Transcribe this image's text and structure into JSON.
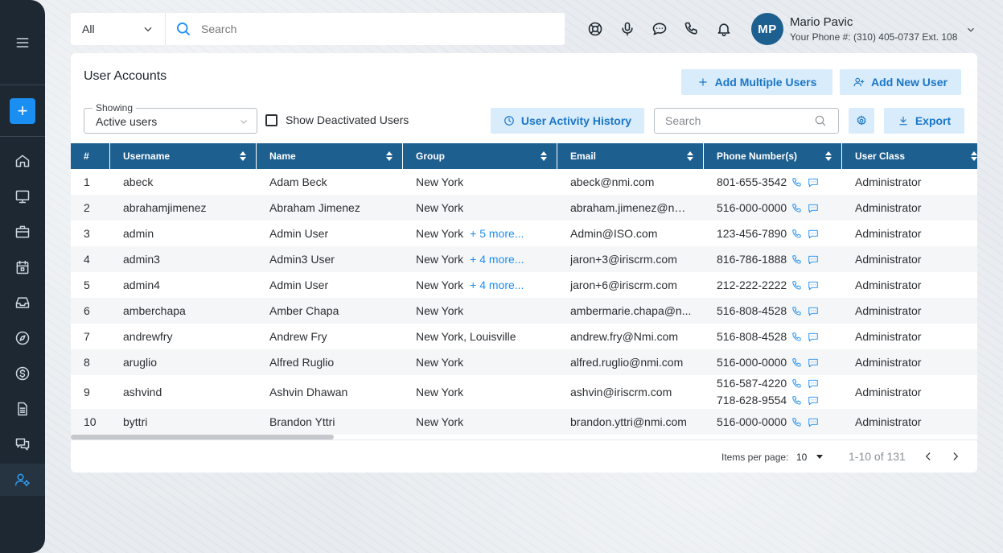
{
  "top": {
    "category": "All",
    "search_placeholder": "Search",
    "user_initials": "MP",
    "user_name": "Mario Pavic",
    "user_phone": "Your Phone #: (310) 405-0737 Ext. 108"
  },
  "page": {
    "title": "User Accounts",
    "add_multiple_label": "Add Multiple Users",
    "add_new_label": "Add New User",
    "showing_label": "Showing",
    "showing_value": "Active users",
    "deactivated_label": "Show Deactivated Users",
    "activity_label": "User Activity History",
    "table_search_placeholder": "Search",
    "export_label": "Export"
  },
  "table": {
    "columns": [
      "#",
      "Username",
      "Name",
      "Group",
      "Email",
      "Phone Number(s)",
      "User Class"
    ],
    "rows": [
      {
        "n": "1",
        "username": "abeck",
        "name": "Adam Beck",
        "group": "New York",
        "more": "",
        "email": "abeck@nmi.com",
        "phones": [
          "801-655-3542"
        ],
        "cls": "Administrator"
      },
      {
        "n": "2",
        "username": "abrahamjimenez",
        "name": "Abraham Jimenez",
        "group": "New York",
        "more": "",
        "email": "abraham.jimenez@nm...",
        "phones": [
          "516-000-0000"
        ],
        "cls": "Administrator"
      },
      {
        "n": "3",
        "username": "admin",
        "name": "Admin User",
        "group": "New York",
        "more": "+ 5 more...",
        "email": "Admin@ISO.com",
        "phones": [
          "123-456-7890"
        ],
        "cls": "Administrator"
      },
      {
        "n": "4",
        "username": "admin3",
        "name": "Admin3 User",
        "group": "New York",
        "more": "+ 4 more...",
        "email": "jaron+3@iriscrm.com",
        "phones": [
          "816-786-1888"
        ],
        "cls": "Administrator"
      },
      {
        "n": "5",
        "username": "admin4",
        "name": "Admin User",
        "group": "New York",
        "more": "+ 4 more...",
        "email": "jaron+6@iriscrm.com",
        "phones": [
          "212-222-2222"
        ],
        "cls": "Administrator"
      },
      {
        "n": "6",
        "username": "amberchapa",
        "name": "Amber Chapa",
        "group": "New York",
        "more": "",
        "email": "ambermarie.chapa@n...",
        "phones": [
          "516-808-4528"
        ],
        "cls": "Administrator"
      },
      {
        "n": "7",
        "username": "andrewfry",
        "name": "Andrew Fry",
        "group": "New York,  Louisville",
        "more": "",
        "email": "andrew.fry@Nmi.com",
        "phones": [
          "516-808-4528"
        ],
        "cls": "Administrator"
      },
      {
        "n": "8",
        "username": "aruglio",
        "name": "Alfred Ruglio",
        "group": "New York",
        "more": "",
        "email": "alfred.ruglio@nmi.com",
        "phones": [
          "516-000-0000"
        ],
        "cls": "Administrator"
      },
      {
        "n": "9",
        "username": "ashvind",
        "name": "Ashvin Dhawan",
        "group": "New York",
        "more": "",
        "email": "ashvin@iriscrm.com",
        "phones": [
          "516-587-4220",
          "718-628-9554"
        ],
        "cls": "Administrator"
      },
      {
        "n": "10",
        "username": "byttri",
        "name": "Brandon Yttri",
        "group": "New York",
        "more": "",
        "email": "brandon.yttri@nmi.com",
        "phones": [
          "516-000-0000"
        ],
        "cls": "Administrator"
      }
    ]
  },
  "pagination": {
    "items_per_page_label": "Items per page:",
    "items_per_page": "10",
    "range": "1-10 of 131"
  },
  "colors": {
    "header_blue": "#1d5f8f",
    "accent_blue": "#1b8ef2",
    "sidebar": "#1d2833",
    "light_button": "#d9ecfb"
  }
}
